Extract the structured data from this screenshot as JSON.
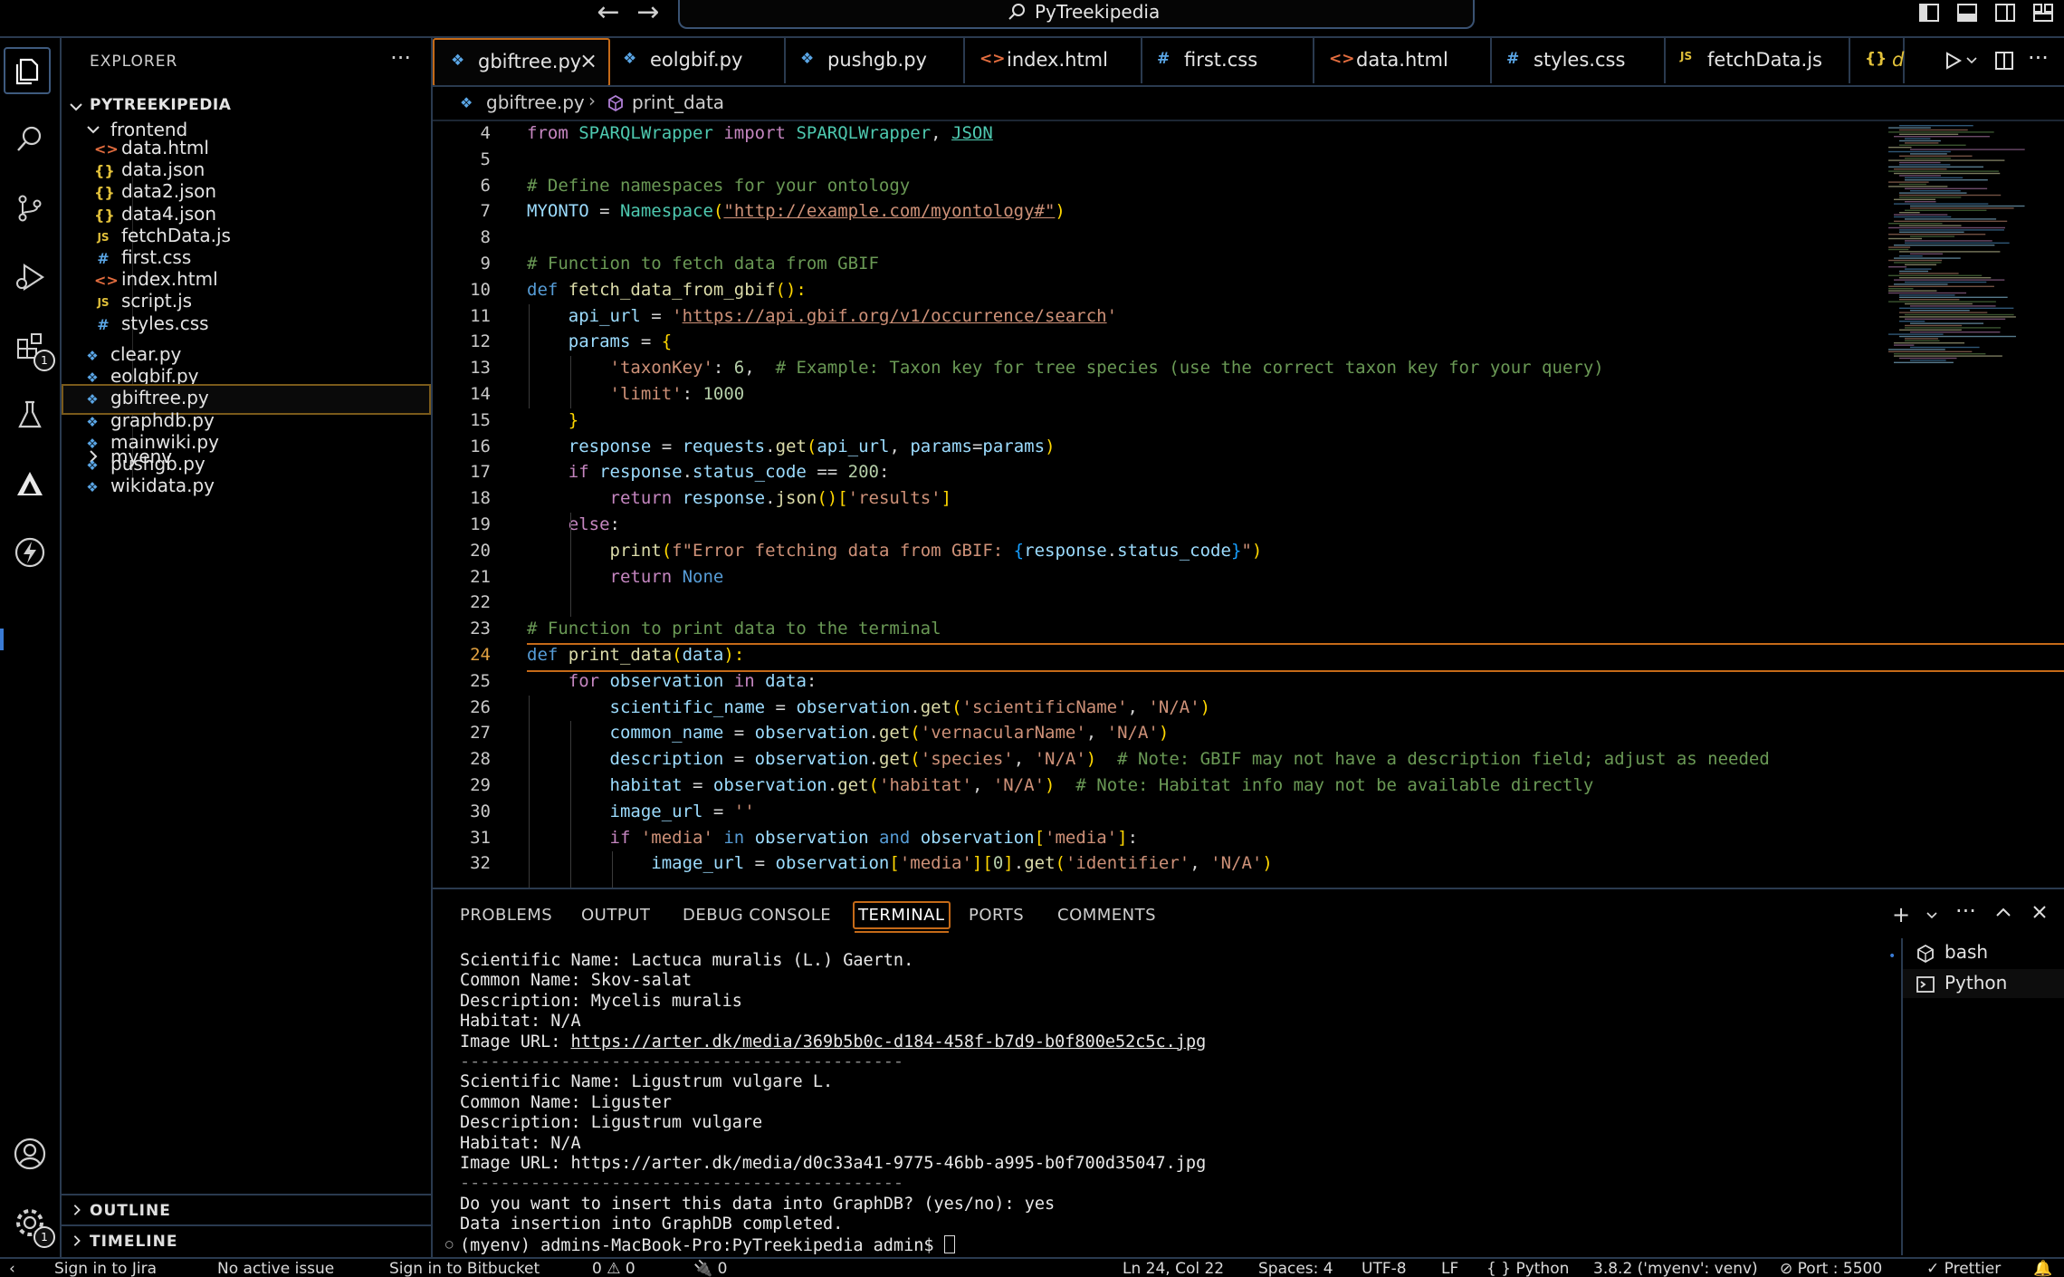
{
  "window": {
    "title": "PyTreekipedia"
  },
  "activity_bar": {
    "items": [
      "explorer-icon",
      "search-icon",
      "source-control-icon",
      "run-debug-icon",
      "extensions-icon",
      "testing-icon",
      "deploy-icon",
      "lightning-icon"
    ],
    "extensions_badge": "1",
    "settings_badge": "1"
  },
  "explorer": {
    "title": "EXPLORER",
    "more": "···",
    "root": "PYTREEKIPEDIA",
    "frontend_folder": "frontend",
    "frontend_files": [
      {
        "name": "data.html",
        "type": "html"
      },
      {
        "name": "data.json",
        "type": "json"
      },
      {
        "name": "data2.json",
        "type": "json"
      },
      {
        "name": "data4.json",
        "type": "json"
      },
      {
        "name": "fetchData.js",
        "type": "js"
      },
      {
        "name": "first.css",
        "type": "css"
      },
      {
        "name": "index.html",
        "type": "html"
      },
      {
        "name": "script.js",
        "type": "js"
      },
      {
        "name": "styles.css",
        "type": "css"
      }
    ],
    "myenv_folder": "myenv",
    "root_files": [
      "clear.py",
      "eolgbif.py",
      "gbiftree.py",
      "graphdb.py",
      "mainwiki.py",
      "pushgb.py",
      "wikidata.py"
    ],
    "selected_file": "gbiftree.py",
    "outline": "OUTLINE",
    "timeline": "TIMELINE"
  },
  "tabs": [
    {
      "label": "gbiftree.py",
      "type": "py",
      "active": true
    },
    {
      "label": "eolgbif.py",
      "type": "py"
    },
    {
      "label": "pushgb.py",
      "type": "py"
    },
    {
      "label": "index.html",
      "type": "html"
    },
    {
      "label": "first.css",
      "type": "css"
    },
    {
      "label": "data.html",
      "type": "html"
    },
    {
      "label": "styles.css",
      "type": "css"
    },
    {
      "label": "fetchData.js",
      "type": "js"
    },
    {
      "label": "d",
      "type": "json"
    }
  ],
  "breadcrumb": {
    "file": "gbiftree.py",
    "symbol": "print_data"
  },
  "editor": {
    "current_line": 24,
    "lines": [
      {
        "n": 4,
        "tokens": [
          [
            "from ",
            "k-ctl"
          ],
          [
            "SPARQLWrapper ",
            "k-cls"
          ],
          [
            "import ",
            "k-ctl"
          ],
          [
            "SPARQLWrapper",
            "k-cls"
          ],
          [
            ", ",
            "k-op"
          ],
          [
            "JSON",
            "k-cls k-ul"
          ]
        ]
      },
      {
        "n": 5,
        "tokens": []
      },
      {
        "n": 6,
        "tokens": [
          [
            "# Define namespaces for your ontology",
            "k-cm"
          ]
        ]
      },
      {
        "n": 7,
        "tokens": [
          [
            "MYONTO",
            "k-var"
          ],
          [
            " = ",
            "k-op"
          ],
          [
            "Namespace",
            "k-cls"
          ],
          [
            "(",
            "k-br"
          ],
          [
            "\"http://example.com/myontology#\"",
            "k-str k-ul"
          ],
          [
            ")",
            "k-br"
          ]
        ]
      },
      {
        "n": 8,
        "tokens": []
      },
      {
        "n": 9,
        "tokens": [
          [
            "# Function to fetch data from GBIF",
            "k-cm"
          ]
        ]
      },
      {
        "n": 10,
        "tokens": [
          [
            "def ",
            "k-kw"
          ],
          [
            "fetch_data_from_gbif",
            "k-fn"
          ],
          [
            "():",
            "k-br"
          ]
        ]
      },
      {
        "n": 11,
        "tokens": [
          [
            "    api_url",
            "k-var"
          ],
          [
            " = ",
            "k-op"
          ],
          [
            "'",
            "k-str"
          ],
          [
            "https://api.gbif.org/v1/occurrence/search",
            "k-str k-ul"
          ],
          [
            "'",
            "k-str"
          ]
        ]
      },
      {
        "n": 12,
        "tokens": [
          [
            "    params",
            "k-var"
          ],
          [
            " = ",
            "k-op"
          ],
          [
            "{",
            "k-br"
          ]
        ]
      },
      {
        "n": 13,
        "tokens": [
          [
            "        'taxonKey'",
            "k-str"
          ],
          [
            ": ",
            "k-op"
          ],
          [
            "6",
            "k-num"
          ],
          [
            ",  ",
            "k-op"
          ],
          [
            "# Example: Taxon key for tree species (use the correct taxon key for your query)",
            "k-cm"
          ]
        ]
      },
      {
        "n": 14,
        "tokens": [
          [
            "        'limit'",
            "k-str"
          ],
          [
            ": ",
            "k-op"
          ],
          [
            "1000",
            "k-num"
          ]
        ]
      },
      {
        "n": 15,
        "tokens": [
          [
            "    }",
            "k-br"
          ]
        ]
      },
      {
        "n": 16,
        "tokens": [
          [
            "    response",
            "k-var"
          ],
          [
            " = ",
            "k-op"
          ],
          [
            "requests",
            "k-var"
          ],
          [
            ".",
            "k-op"
          ],
          [
            "get",
            "k-fn"
          ],
          [
            "(",
            "k-br"
          ],
          [
            "api_url",
            "k-var"
          ],
          [
            ", ",
            "k-op"
          ],
          [
            "params",
            "k-var"
          ],
          [
            "=",
            "k-op"
          ],
          [
            "params",
            "k-var"
          ],
          [
            ")",
            "k-br"
          ]
        ]
      },
      {
        "n": 17,
        "tokens": [
          [
            "    if ",
            "k-ctl"
          ],
          [
            "response",
            "k-var"
          ],
          [
            ".",
            "k-op"
          ],
          [
            "status_code",
            "k-var"
          ],
          [
            " == ",
            "k-op"
          ],
          [
            "200",
            "k-num"
          ],
          [
            ":",
            "k-op"
          ]
        ]
      },
      {
        "n": 18,
        "tokens": [
          [
            "        return ",
            "k-ctl"
          ],
          [
            "response",
            "k-var"
          ],
          [
            ".",
            "k-op"
          ],
          [
            "json",
            "k-fn"
          ],
          [
            "()",
            "k-br"
          ],
          [
            "[",
            "k-br"
          ],
          [
            "'results'",
            "k-str"
          ],
          [
            "]",
            "k-br"
          ]
        ]
      },
      {
        "n": 19,
        "tokens": [
          [
            "    else",
            "k-ctl"
          ],
          [
            ":",
            "k-op"
          ]
        ]
      },
      {
        "n": 20,
        "tokens": [
          [
            "        print",
            "k-fn"
          ],
          [
            "(",
            "k-br"
          ],
          [
            "f\"Error fetching data from GBIF: ",
            "k-str"
          ],
          [
            "{",
            "k-br3"
          ],
          [
            "response",
            "k-var"
          ],
          [
            ".",
            "k-op"
          ],
          [
            "status_code",
            "k-var"
          ],
          [
            "}",
            "k-br3"
          ],
          [
            "\"",
            "k-str"
          ],
          [
            ")",
            "k-br"
          ]
        ]
      },
      {
        "n": 21,
        "tokens": [
          [
            "        return ",
            "k-ctl"
          ],
          [
            "None",
            "k-kw"
          ]
        ]
      },
      {
        "n": 22,
        "tokens": []
      },
      {
        "n": 23,
        "tokens": [
          [
            "# Function to print data to the terminal",
            "k-cm"
          ]
        ]
      },
      {
        "n": 24,
        "tokens": [
          [
            "def ",
            "k-kw"
          ],
          [
            "print_data",
            "k-fn"
          ],
          [
            "(",
            "k-br"
          ],
          [
            "data",
            "k-var"
          ],
          [
            "):",
            "k-br"
          ]
        ]
      },
      {
        "n": 25,
        "tokens": [
          [
            "    for ",
            "k-ctl"
          ],
          [
            "observation ",
            "k-var"
          ],
          [
            "in ",
            "k-ctl"
          ],
          [
            "data",
            "k-var"
          ],
          [
            ":",
            "k-op"
          ]
        ]
      },
      {
        "n": 26,
        "tokens": [
          [
            "        scientific_name",
            "k-var"
          ],
          [
            " = ",
            "k-op"
          ],
          [
            "observation",
            "k-var"
          ],
          [
            ".",
            "k-op"
          ],
          [
            "get",
            "k-fn"
          ],
          [
            "(",
            "k-br"
          ],
          [
            "'scientificName'",
            "k-str"
          ],
          [
            ", ",
            "k-op"
          ],
          [
            "'N/A'",
            "k-str"
          ],
          [
            ")",
            "k-br"
          ]
        ]
      },
      {
        "n": 27,
        "tokens": [
          [
            "        common_name",
            "k-var"
          ],
          [
            " = ",
            "k-op"
          ],
          [
            "observation",
            "k-var"
          ],
          [
            ".",
            "k-op"
          ],
          [
            "get",
            "k-fn"
          ],
          [
            "(",
            "k-br"
          ],
          [
            "'vernacularName'",
            "k-str"
          ],
          [
            ", ",
            "k-op"
          ],
          [
            "'N/A'",
            "k-str"
          ],
          [
            ")",
            "k-br"
          ]
        ]
      },
      {
        "n": 28,
        "tokens": [
          [
            "        description",
            "k-var"
          ],
          [
            " = ",
            "k-op"
          ],
          [
            "observation",
            "k-var"
          ],
          [
            ".",
            "k-op"
          ],
          [
            "get",
            "k-fn"
          ],
          [
            "(",
            "k-br"
          ],
          [
            "'species'",
            "k-str"
          ],
          [
            ", ",
            "k-op"
          ],
          [
            "'N/A'",
            "k-str"
          ],
          [
            ")",
            "k-br"
          ],
          [
            "  # Note: GBIF may not have a description field; adjust as needed",
            "k-cm"
          ]
        ]
      },
      {
        "n": 29,
        "tokens": [
          [
            "        habitat",
            "k-var"
          ],
          [
            " = ",
            "k-op"
          ],
          [
            "observation",
            "k-var"
          ],
          [
            ".",
            "k-op"
          ],
          [
            "get",
            "k-fn"
          ],
          [
            "(",
            "k-br"
          ],
          [
            "'habitat'",
            "k-str"
          ],
          [
            ", ",
            "k-op"
          ],
          [
            "'N/A'",
            "k-str"
          ],
          [
            ")",
            "k-br"
          ],
          [
            "  # Note: Habitat info may not be available directly",
            "k-cm"
          ]
        ]
      },
      {
        "n": 30,
        "tokens": [
          [
            "        image_url",
            "k-var"
          ],
          [
            " = ",
            "k-op"
          ],
          [
            "''",
            "k-str"
          ]
        ]
      },
      {
        "n": 31,
        "tokens": [
          [
            "        if ",
            "k-ctl"
          ],
          [
            "'media' ",
            "k-str"
          ],
          [
            "in ",
            "k-kw"
          ],
          [
            "observation ",
            "k-var"
          ],
          [
            "and ",
            "k-kw"
          ],
          [
            "observation",
            "k-var"
          ],
          [
            "[",
            "k-br"
          ],
          [
            "'media'",
            "k-str"
          ],
          [
            "]",
            "k-br"
          ],
          [
            ":",
            "k-op"
          ]
        ]
      },
      {
        "n": 32,
        "tokens": [
          [
            "            image_url",
            "k-var"
          ],
          [
            " = ",
            "k-op"
          ],
          [
            "observation",
            "k-var"
          ],
          [
            "[",
            "k-br"
          ],
          [
            "'media'",
            "k-str"
          ],
          [
            "]",
            "k-br"
          ],
          [
            "[",
            "k-br"
          ],
          [
            "0",
            "k-num"
          ],
          [
            "]",
            "k-br"
          ],
          [
            ".",
            "k-op"
          ],
          [
            "get",
            "k-fn"
          ],
          [
            "(",
            "k-br"
          ],
          [
            "'identifier'",
            "k-str"
          ],
          [
            ", ",
            "k-op"
          ],
          [
            "'N/A'",
            "k-str"
          ],
          [
            ")",
            "k-br"
          ]
        ]
      }
    ]
  },
  "panel": {
    "tabs": [
      "PROBLEMS",
      "OUTPUT",
      "DEBUG CONSOLE",
      "TERMINAL",
      "PORTS",
      "COMMENTS"
    ],
    "active_tab": "TERMINAL",
    "terminal_lines": [
      {
        "text": "Scientific Name: Lactuca muralis (L.) Gaertn."
      },
      {
        "text": "Common Name: Skov-salat"
      },
      {
        "text": "Description: Mycelis muralis"
      },
      {
        "text": "Habitat: N/A"
      },
      {
        "text": "Image URL: ",
        "link": "https://arter.dk/media/369b5b0c-d184-458f-b7d9-b0f800e52c5c.jpg"
      },
      {
        "text": "--------------------------------------------",
        "sep": true
      },
      {
        "text": "Scientific Name: Ligustrum vulgare L."
      },
      {
        "text": "Common Name: Liguster"
      },
      {
        "text": "Description: Ligustrum vulgare"
      },
      {
        "text": "Habitat: N/A"
      },
      {
        "text": "Image URL: https://arter.dk/media/d0c33a41-9775-46bb-a995-b0f700d35047.jpg"
      },
      {
        "text": "--------------------------------------------",
        "sep": true
      },
      {
        "text": "Do you want to insert this data into GraphDB? (yes/no): yes"
      },
      {
        "text": "Data insertion into GraphDB completed."
      },
      {
        "text": "(myenv) admins-MacBook-Pro:PyTreekipedia admin$ ",
        "prompt": true
      }
    ],
    "terminals": [
      "bash",
      "Python"
    ]
  },
  "statusbar": {
    "items": [
      "Sign in to Jira",
      "No active issue",
      "Sign in to Bitbucket",
      "0 ⚠ 0",
      "🔌 0",
      "Ln 24, Col 22",
      "Spaces: 4",
      "UTF-8",
      "LF",
      "{ } Python",
      "3.8.2 ('myenv': venv)",
      "⊘ Port : 5500",
      "✓ Prettier"
    ]
  }
}
